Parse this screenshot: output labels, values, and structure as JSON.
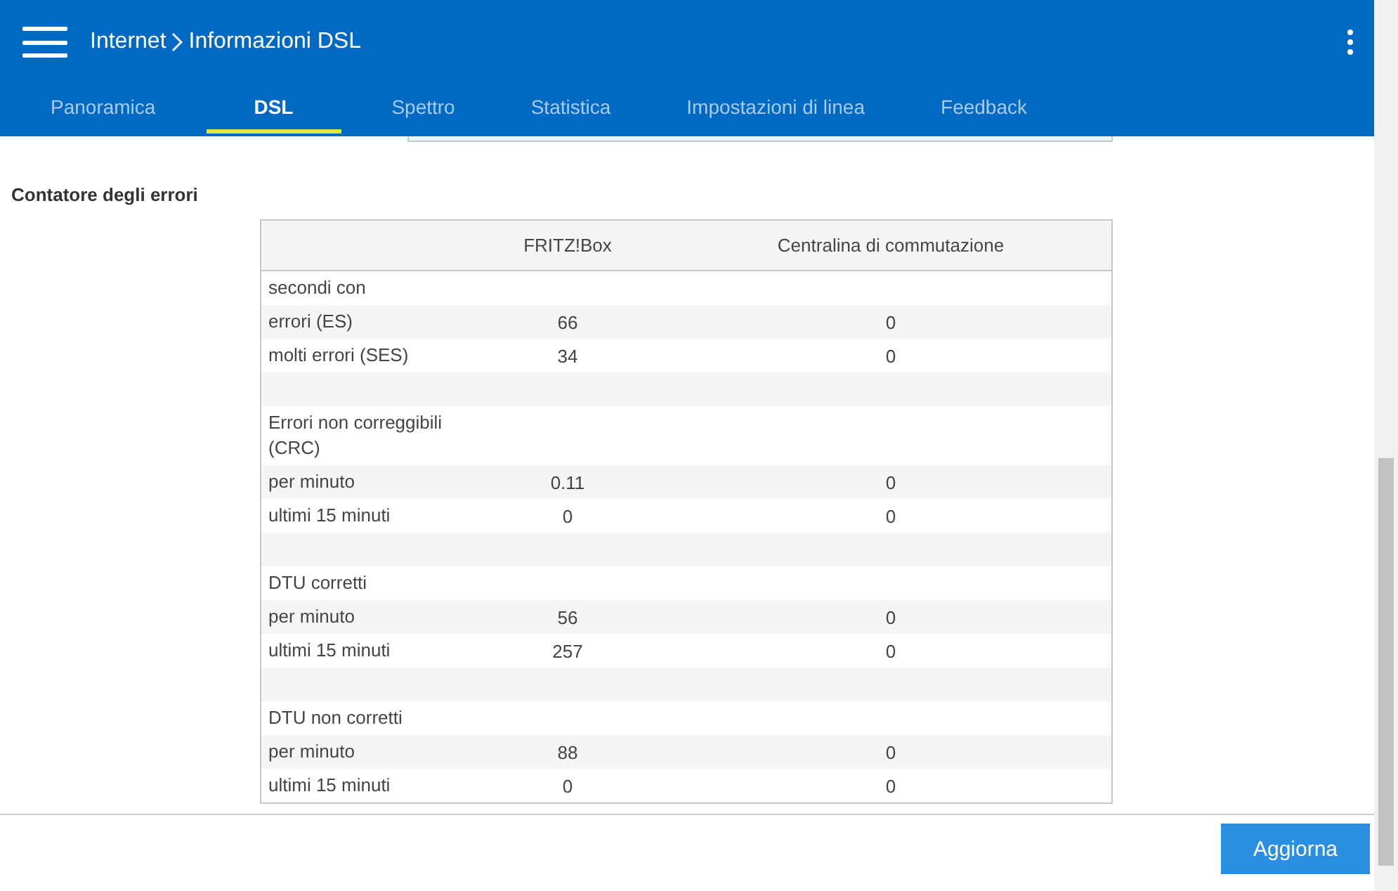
{
  "header": {
    "breadcrumb": [
      {
        "label": "Internet"
      },
      {
        "label": "Informazioni DSL"
      }
    ]
  },
  "tabs": [
    {
      "label": "Panoramica",
      "selected": false
    },
    {
      "label": "DSL",
      "selected": true
    },
    {
      "label": "Spettro",
      "selected": false
    },
    {
      "label": "Statistica",
      "selected": false
    },
    {
      "label": "Impostazioni di linea",
      "selected": false
    },
    {
      "label": "Feedback",
      "selected": false
    }
  ],
  "section_title": "Contatore degli errori",
  "table": {
    "columns": [
      "FRITZ!Box",
      "Centralina di commutazione"
    ],
    "rows": [
      {
        "kind": "group",
        "label": "secondi con"
      },
      {
        "kind": "value",
        "label": "errori (ES)",
        "values": [
          "66",
          "0"
        ]
      },
      {
        "kind": "value",
        "label": "molti errori (SES)",
        "values": [
          "34",
          "0"
        ]
      },
      {
        "kind": "spacer"
      },
      {
        "kind": "group",
        "label": "Errori non correggibili (CRC)"
      },
      {
        "kind": "value",
        "label": "per minuto",
        "values": [
          "0.11",
          "0"
        ]
      },
      {
        "kind": "value",
        "label": "ultimi 15 minuti",
        "values": [
          "0",
          "0"
        ]
      },
      {
        "kind": "spacer"
      },
      {
        "kind": "group",
        "label": "DTU corretti"
      },
      {
        "kind": "value",
        "label": "per minuto",
        "values": [
          "56",
          "0"
        ]
      },
      {
        "kind": "value",
        "label": "ultimi 15 minuti",
        "values": [
          "257",
          "0"
        ]
      },
      {
        "kind": "spacer"
      },
      {
        "kind": "group",
        "label": "DTU non corretti"
      },
      {
        "kind": "value",
        "label": "per minuto",
        "values": [
          "88",
          "0"
        ]
      },
      {
        "kind": "value",
        "label": "ultimi 15 minuti",
        "values": [
          "0",
          "0"
        ]
      }
    ]
  },
  "buttons": [
    {
      "label": "Aggiorna"
    }
  ]
}
